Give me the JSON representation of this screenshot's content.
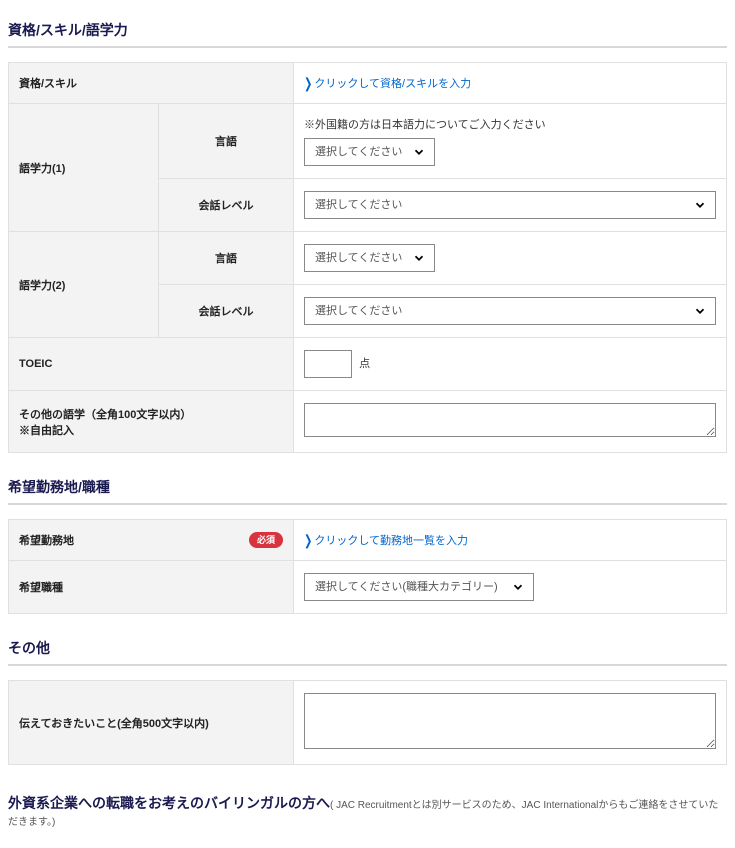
{
  "sections": {
    "skills": {
      "title": "資格/スキル/語学力",
      "qualifications_label": "資格/スキル",
      "qualifications_link": "クリックして資格/スキルを入力",
      "lang1_label": "語学力(1)",
      "lang2_label": "語学力(2)",
      "lang_sub_language": "言語",
      "lang_sub_level": "会話レベル",
      "lang_note": "※外国籍の方は日本語力についてご入力ください",
      "select_placeholder": "選択してください",
      "toeic_label": "TOEIC",
      "toeic_unit": "点",
      "other_lang_label": "その他の語学（全角100文字以内）\n※自由記入"
    },
    "workplace": {
      "title": "希望勤務地/職種",
      "location_label": "希望勤務地",
      "required_badge": "必須",
      "location_link": "クリックして勤務地一覧を入力",
      "jobtype_label": "希望職種",
      "jobtype_select": "選択してください(職種大カテゴリー)"
    },
    "other": {
      "title": "その他",
      "message_label": "伝えておきたいこと(全角500文字以内)"
    },
    "footer": {
      "lead": "外資系企業への転職をお考えのバイリンガルの方へ",
      "tail": "( JAC Recruitmentとは別サービスのため、JAC Internationalからもご連絡をさせていただきます。)"
    }
  }
}
